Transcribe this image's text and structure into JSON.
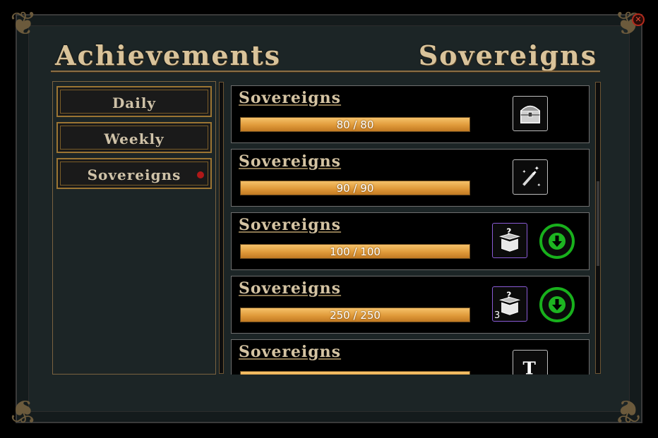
{
  "window": {
    "title_left": "Achievements",
    "title_right": "Sovereigns"
  },
  "tabs": [
    {
      "label": "Daily",
      "selected": false,
      "alert": false
    },
    {
      "label": "Weekly",
      "selected": false,
      "alert": false
    },
    {
      "label": "Sovereigns",
      "selected": true,
      "alert": true
    }
  ],
  "achievements": [
    {
      "title": "Sovereigns",
      "progress_text": "80 / 80",
      "progress": 1.0,
      "reward_icon": "treasure-chest-icon",
      "reward_qty": "",
      "claimable": false
    },
    {
      "title": "Sovereigns",
      "progress_text": "90 / 90",
      "progress": 1.0,
      "reward_icon": "magic-wand-icon",
      "reward_qty": "",
      "claimable": false
    },
    {
      "title": "Sovereigns",
      "progress_text": "100 / 100",
      "progress": 1.0,
      "reward_icon": "mystery-box-icon",
      "reward_qty": "",
      "claimable": true
    },
    {
      "title": "Sovereigns",
      "progress_text": "250 / 250",
      "progress": 1.0,
      "reward_icon": "mystery-box-icon",
      "reward_qty": "3",
      "claimable": true
    },
    {
      "title": "Sovereigns",
      "progress_text": "",
      "progress": 1.0,
      "reward_icon": "title-scroll-icon",
      "reward_qty": "",
      "claimable": false
    }
  ],
  "colors": {
    "accent_gold": "#9b7533",
    "progress_orange": "#e09a3a",
    "claim_green": "#18b01c",
    "alert_red": "#b01818"
  }
}
